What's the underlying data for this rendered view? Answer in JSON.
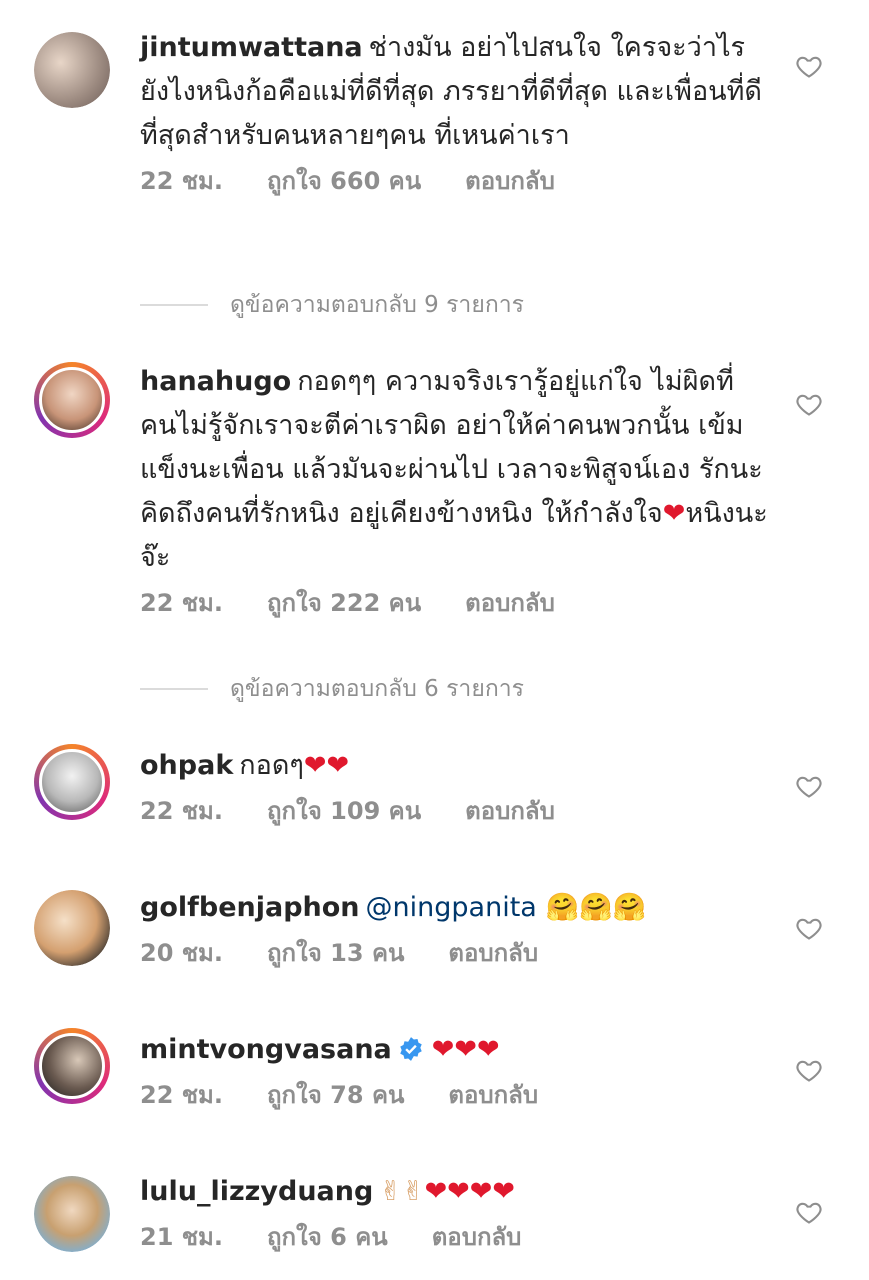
{
  "comments": [
    {
      "username": "jintumwattana",
      "text": "ช่างมัน อย่าไปสนใจ ใครจะว่าไร ยังไงหนิงก้อคือแม่ที่ดีที่สุด ภรรยาที่ดีที่สุด และเพื่อนที่ดีที่สุดสำหรับคนหลายๆคน ที่เหนค่าเรา",
      "time": "22 ชม.",
      "likes": "ถูกใจ 660 คน",
      "reply": "ตอบกลับ",
      "view_replies": "ดูข้อความตอบกลับ 9 รายการ"
    },
    {
      "username": "hanahugo",
      "text": "กอดๆๆ  ความจริงเรารู้อยู่แก่ใจ ไม่ผิดที่คนไม่รู้จักเราจะตีค่าเราผิด อย่าให้ค่าคนพวกนั้น เข้มแข็งนะเพื่อน แล้วมันจะผ่านไป เวลาจะพิสูจน์เอง รักนะ คิดถึงคนที่รักหนิง อยู่เคียงข้างหนิง ให้กำลังใจ",
      "text_after": "หนิงนะจ๊ะ",
      "time": "22 ชม.",
      "likes": "ถูกใจ 222 คน",
      "reply": "ตอบกลับ",
      "view_replies": "ดูข้อความตอบกลับ 6 รายการ"
    },
    {
      "username": "ohpak",
      "text": "กอดๆ",
      "emoji": "❤❤",
      "time": "22 ชม.",
      "likes": "ถูกใจ 109 คน",
      "reply": "ตอบกลับ"
    },
    {
      "username": "golfbenjaphon",
      "mention": "@ningpanita",
      "emoji": "🤗🤗🤗",
      "time": "20 ชม.",
      "likes": "ถูกใจ 13 คน",
      "reply": "ตอบกลับ"
    },
    {
      "username": "mintvongvasana",
      "emoji": "❤❤❤",
      "time": "22 ชม.",
      "likes": "ถูกใจ 78 คน",
      "reply": "ตอบกลับ"
    },
    {
      "username": "lulu_lizzyduang",
      "emoji_peace": "✌✌",
      "emoji": "❤❤❤❤",
      "time": "21 ชม.",
      "likes": "ถูกใจ 6 คน",
      "reply": "ตอบกลับ"
    }
  ]
}
